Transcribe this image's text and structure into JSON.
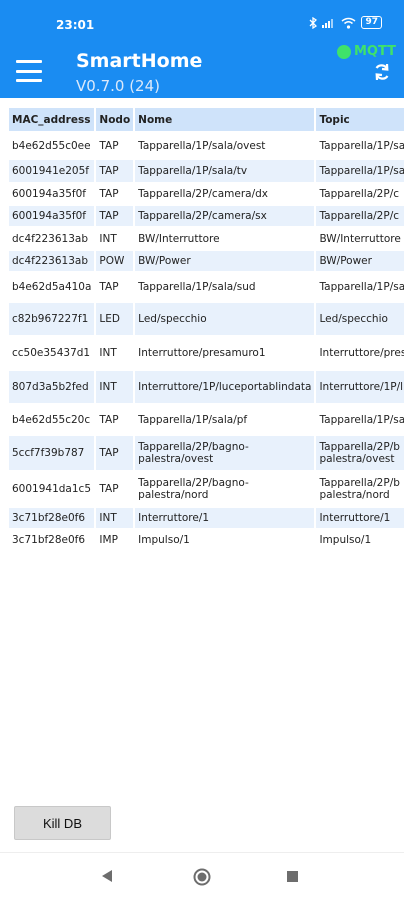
{
  "status_bar": {
    "time": "23:01",
    "battery": "97"
  },
  "app_bar": {
    "title": "SmartHome",
    "version": "V0.7.0 (24)",
    "mqtt_label": "MQTT",
    "mqtt_color": "#3fe26a",
    "accent_color": "#1a8cf2"
  },
  "table": {
    "headers": [
      "MAC_address",
      "Nodo",
      "Nome",
      "Topic"
    ],
    "rows": [
      {
        "mac": "b4e62d55c0ee",
        "nodo": "TAP",
        "nome": "Tapparella/1P/sala/ovest",
        "topic": "Tapparella/1P/sa"
      },
      {
        "mac": "6001941e205f",
        "nodo": "TAP",
        "nome": "Tapparella/1P/sala/tv",
        "topic": "Tapparella/1P/sa"
      },
      {
        "mac": "600194a35f0f",
        "nodo": "TAP",
        "nome": "Tapparella/2P/camera/dx",
        "topic": "Tapparella/2P/c"
      },
      {
        "mac": "600194a35f0f",
        "nodo": "TAP",
        "nome": "Tapparella/2P/camera/sx",
        "topic": "Tapparella/2P/c"
      },
      {
        "mac": "dc4f223613ab",
        "nodo": "INT",
        "nome": "BW/Interruttore",
        "topic": "BW/Interruttore"
      },
      {
        "mac": "dc4f223613ab",
        "nodo": "POW",
        "nome": "BW/Power",
        "topic": "BW/Power"
      },
      {
        "mac": "b4e62d5a410a",
        "nodo": "TAP",
        "nome": "Tapparella/1P/sala/sud",
        "topic": "Tapparella/1P/sa"
      },
      {
        "mac": "c82b967227f1",
        "nodo": "LED",
        "nome": "Led/specchio",
        "topic": "Led/specchio"
      },
      {
        "mac": "cc50e35437d1",
        "nodo": "INT",
        "nome": "Interruttore/presamuro1",
        "topic": "Interruttore/pres"
      },
      {
        "mac": "807d3a5b2fed",
        "nodo": "INT",
        "nome": "Interruttore/1P/luceportablindata",
        "topic": "Interruttore/1P/l"
      },
      {
        "mac": "b4e62d55c20c",
        "nodo": "TAP",
        "nome": "Tapparella/1P/sala/pf",
        "topic": "Tapparella/1P/sa"
      },
      {
        "mac": "5ccf7f39b787",
        "nodo": "TAP",
        "nome": "Tapparella/2P/bagno-\npalestra/ovest",
        "topic": "Tapparella/2P/b\npalestra/ovest"
      },
      {
        "mac": "6001941da1c5",
        "nodo": "TAP",
        "nome": "Tapparella/2P/bagno-\npalestra/nord",
        "topic": "Tapparella/2P/b\npalestra/nord"
      },
      {
        "mac": "3c71bf28e0f6",
        "nodo": "INT",
        "nome": "Interruttore/1",
        "topic": "Interruttore/1"
      },
      {
        "mac": "3c71bf28e0f6",
        "nodo": "IMP",
        "nome": "Impulso/1",
        "topic": "Impulso/1"
      }
    ]
  },
  "buttons": {
    "kill_db": "Kill DB"
  },
  "icons": {
    "menu": "hamburger-menu-icon",
    "sync": "sync-icon",
    "back": "back-icon",
    "home": "home-icon",
    "recent": "recent-apps-icon"
  }
}
